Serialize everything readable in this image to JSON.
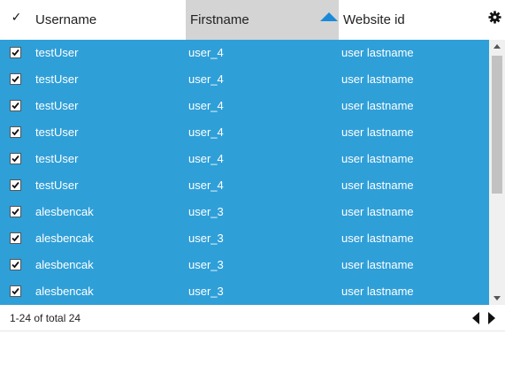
{
  "grid": {
    "columns": [
      {
        "label": "Username",
        "sorted": false
      },
      {
        "label": "Firstname",
        "sorted": true,
        "sort_direction": "asc"
      },
      {
        "label": "Website id",
        "sorted": false
      }
    ],
    "select_all_checked": true,
    "settings_icon": "gear-icon",
    "rows": [
      {
        "username": "testUser",
        "firstname": "user_4",
        "website_id": "user lastname",
        "checked": true
      },
      {
        "username": "testUser",
        "firstname": "user_4",
        "website_id": "user lastname",
        "checked": true
      },
      {
        "username": "testUser",
        "firstname": "user_4",
        "website_id": "user lastname",
        "checked": true
      },
      {
        "username": "testUser",
        "firstname": "user_4",
        "website_id": "user lastname",
        "checked": true
      },
      {
        "username": "testUser",
        "firstname": "user_4",
        "website_id": "user lastname",
        "checked": true
      },
      {
        "username": "testUser",
        "firstname": "user_4",
        "website_id": "user lastname",
        "checked": true
      },
      {
        "username": "alesbencak",
        "firstname": "user_3",
        "website_id": "user lastname",
        "checked": true
      },
      {
        "username": "alesbencak",
        "firstname": "user_3",
        "website_id": "user lastname",
        "checked": true
      },
      {
        "username": "alesbencak",
        "firstname": "user_3",
        "website_id": "user lastname",
        "checked": true
      },
      {
        "username": "alesbencak",
        "firstname": "user_3",
        "website_id": "user lastname",
        "checked": true
      }
    ],
    "selection_color": "#2f9fd8",
    "sort_indicator_color": "#1a8ad8"
  },
  "footer": {
    "pager_info": "1-24 of total 24"
  }
}
